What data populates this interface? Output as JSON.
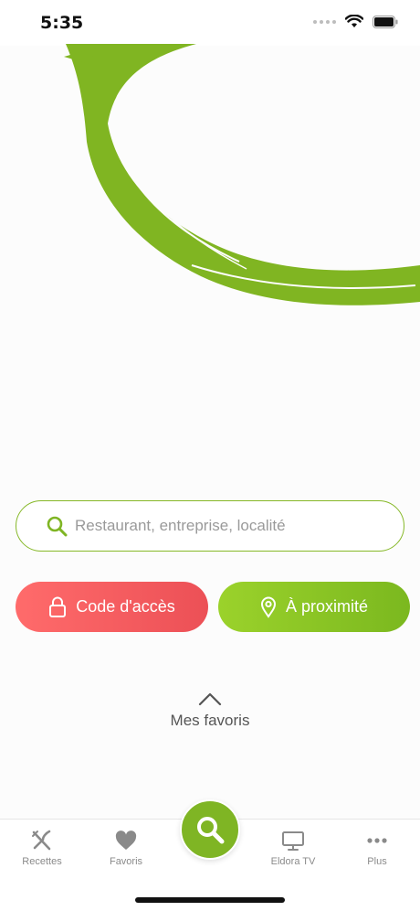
{
  "status": {
    "time": "5:35"
  },
  "search": {
    "placeholder": "Restaurant, entreprise, localité"
  },
  "buttons": {
    "access_code": "Code d'accès",
    "nearby": "À proximité"
  },
  "favorites": {
    "label": "Mes favoris"
  },
  "tabbar": {
    "items": [
      {
        "label": "Recettes",
        "icon": "utensils-icon"
      },
      {
        "label": "Favoris",
        "icon": "heart-icon"
      },
      {
        "label": "Eldora TV",
        "icon": "monitor-icon"
      },
      {
        "label": "Plus",
        "icon": "more-dots-icon"
      }
    ],
    "center_icon": "search-icon"
  },
  "colors": {
    "brand_green": "#7fb524",
    "accent_red": "#ee5357",
    "tab_gray": "#8a8a8a"
  }
}
